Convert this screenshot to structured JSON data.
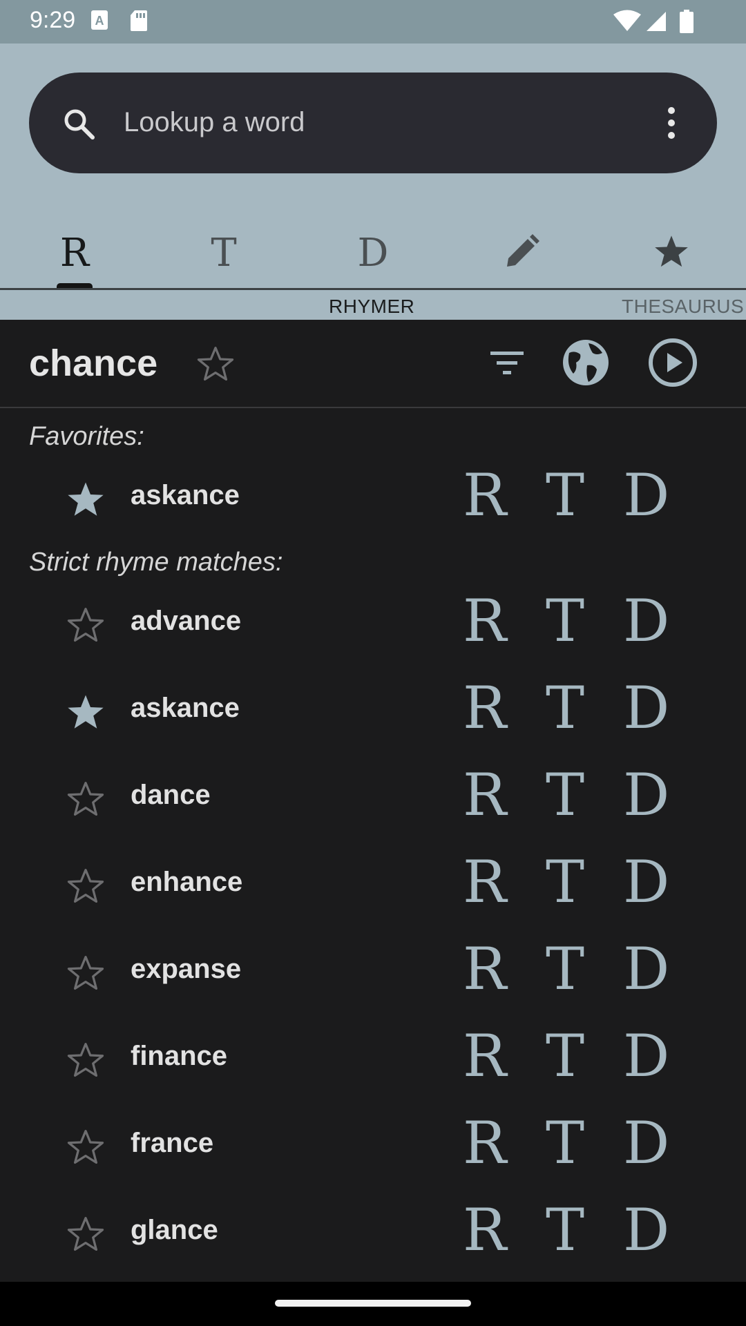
{
  "status_bar": {
    "time": "9:29",
    "icons": [
      "text-a-icon",
      "sd-card-icon",
      "wifi-icon",
      "signal-icon",
      "battery-icon"
    ]
  },
  "search": {
    "placeholder": "Lookup a word"
  },
  "tabs": [
    {
      "glyph": "R",
      "name": "rhymer"
    },
    {
      "glyph": "T",
      "name": "thesaurus"
    },
    {
      "glyph": "D",
      "name": "dictionary"
    },
    {
      "glyph": "",
      "name": "edit",
      "icon": "pencil-icon"
    },
    {
      "glyph": "",
      "name": "favorites",
      "icon": "star-icon"
    }
  ],
  "page_labels": {
    "current": "RHYMER",
    "next": "THESAURUS"
  },
  "word_header": {
    "word": "chance"
  },
  "sections": {
    "favorites_title": "Favorites:",
    "strict_title": "Strict rhyme matches:"
  },
  "action_glyphs": {
    "rhyme": "R",
    "thesaurus": "T",
    "dictionary": "D"
  },
  "favorites": [
    {
      "word": "askance",
      "favorited": true
    }
  ],
  "strict_matches": [
    {
      "word": "advance",
      "favorited": false
    },
    {
      "word": "askance",
      "favorited": true
    },
    {
      "word": "dance",
      "favorited": false
    },
    {
      "word": "enhance",
      "favorited": false
    },
    {
      "word": "expanse",
      "favorited": false
    },
    {
      "word": "finance",
      "favorited": false
    },
    {
      "word": "france",
      "favorited": false
    },
    {
      "word": "glance",
      "favorited": false
    }
  ],
  "colors": {
    "status_bar": "#83989f",
    "header": "#a6b8c1",
    "search_bg": "#2a2a31",
    "body_bg": "#1b1b1c",
    "accent": "#a6b8c1",
    "star_filled": "#a6b8c1",
    "star_outline": "#6e6e70"
  }
}
